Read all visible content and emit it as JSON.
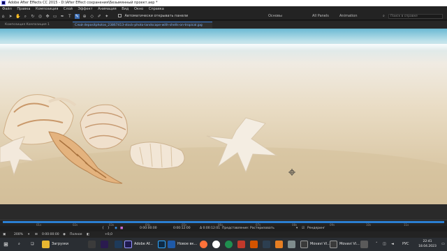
{
  "window": {
    "title": "Adobe After Effects CC 2015 - D:\\After Effect сохранения\\Безымянный проект.aep *"
  },
  "menu": [
    "Файл",
    "Правка",
    "Композиция",
    "Слой",
    "Эффект",
    "Анимация",
    "Вид",
    "Окно",
    "Справка"
  ],
  "toolbar": {
    "auto_open_label": "Автоматически открывать панели",
    "workspaces": [
      "Основы",
      "All Panels",
      "Animation"
    ],
    "search_placeholder": "Поиск в справке"
  },
  "tabs": {
    "composition": "Композиция Композиция 1",
    "layer": "Слой  depositphotos_23867413-stock-photo-landscape-with-shells-on-tropical.jpg"
  },
  "timeline": {
    "ticks": [
      "01s",
      "02s",
      "03s",
      "04s",
      "05s",
      "06s",
      "07s",
      "08s",
      "09s",
      "10s",
      "11s"
    ],
    "in_point": "0:00:00:00",
    "out_point": "0:00:12:00",
    "duration": "Δ 0:00:12:01",
    "view_label": "Представление:",
    "view_value": "Растеризовать",
    "render_label": "Рендеринг"
  },
  "statusbar": {
    "zoom": "200%",
    "timecode": "0:00:00:00",
    "quality": "Полное",
    "exposure": "+0,0"
  },
  "taskbar": {
    "apps": [
      {
        "icon": "folder-icon",
        "label": "Загрузки",
        "color": "#e8b631"
      },
      {
        "icon": "premiere-icon",
        "label": "",
        "color": "#2a1a4f"
      },
      {
        "icon": "after-effects-icon",
        "label": "Adobe Af...",
        "color": "#1f1a4f"
      },
      {
        "icon": "photoshop-icon",
        "label": "",
        "color": "#0e2a45"
      },
      {
        "icon": "word-icon",
        "label": "Новое вк...",
        "color": "#1f5aa8"
      },
      {
        "icon": "movavi-icon",
        "label": "Movavi Vi...",
        "color": "#3a3a3a"
      },
      {
        "icon": "movavi-editor-icon",
        "label": "Movavi Vi...",
        "color": "#3a3a3a"
      }
    ],
    "language": "РУС",
    "time": "22:41",
    "date": "18.04.2023"
  },
  "colors": {
    "accent": "#2b7fd2",
    "tab_highlight": "#7fb6ff",
    "panel": "#232323"
  }
}
